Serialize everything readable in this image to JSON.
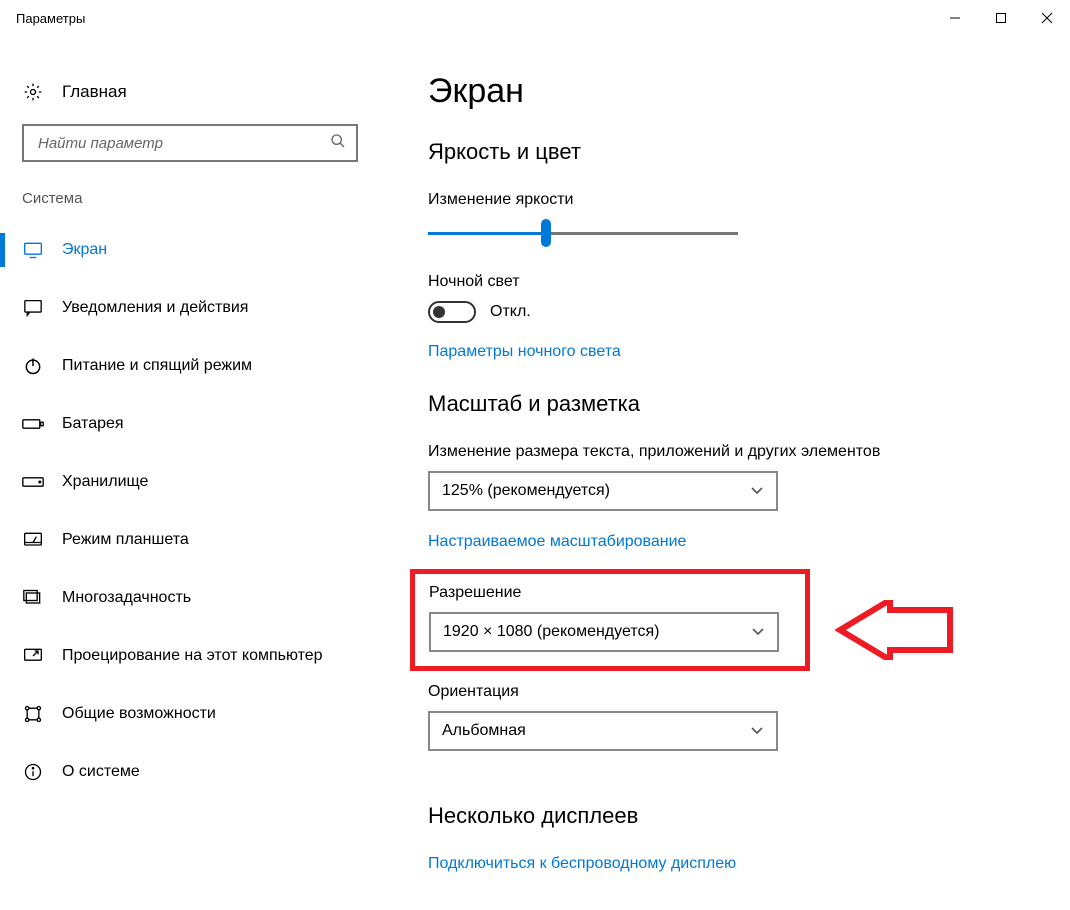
{
  "window": {
    "title": "Параметры"
  },
  "sidebar": {
    "home_label": "Главная",
    "search_placeholder": "Найти параметр",
    "section_label": "Система",
    "items": [
      {
        "label": "Экран"
      },
      {
        "label": "Уведомления и действия"
      },
      {
        "label": "Питание и спящий режим"
      },
      {
        "label": "Батарея"
      },
      {
        "label": "Хранилище"
      },
      {
        "label": "Режим планшета"
      },
      {
        "label": "Многозадачность"
      },
      {
        "label": "Проецирование на этот компьютер"
      },
      {
        "label": "Общие возможности"
      },
      {
        "label": "О системе"
      }
    ]
  },
  "main": {
    "title": "Экран",
    "brightness": {
      "heading": "Яркость и цвет",
      "label": "Изменение яркости",
      "night_light_label": "Ночной свет",
      "night_light_state": "Откл.",
      "night_light_link": "Параметры ночного света"
    },
    "scale": {
      "heading": "Масштаб и разметка",
      "label": "Изменение размера текста, приложений и других элементов",
      "value": "125% (рекомендуется)",
      "custom_link": "Настраиваемое масштабирование",
      "resolution_label": "Разрешение",
      "resolution_value": "1920 × 1080 (рекомендуется)",
      "orientation_label": "Ориентация",
      "orientation_value": "Альбомная"
    },
    "multi": {
      "heading": "Несколько дисплеев",
      "wireless_link": "Подключиться к беспроводному дисплею"
    }
  }
}
